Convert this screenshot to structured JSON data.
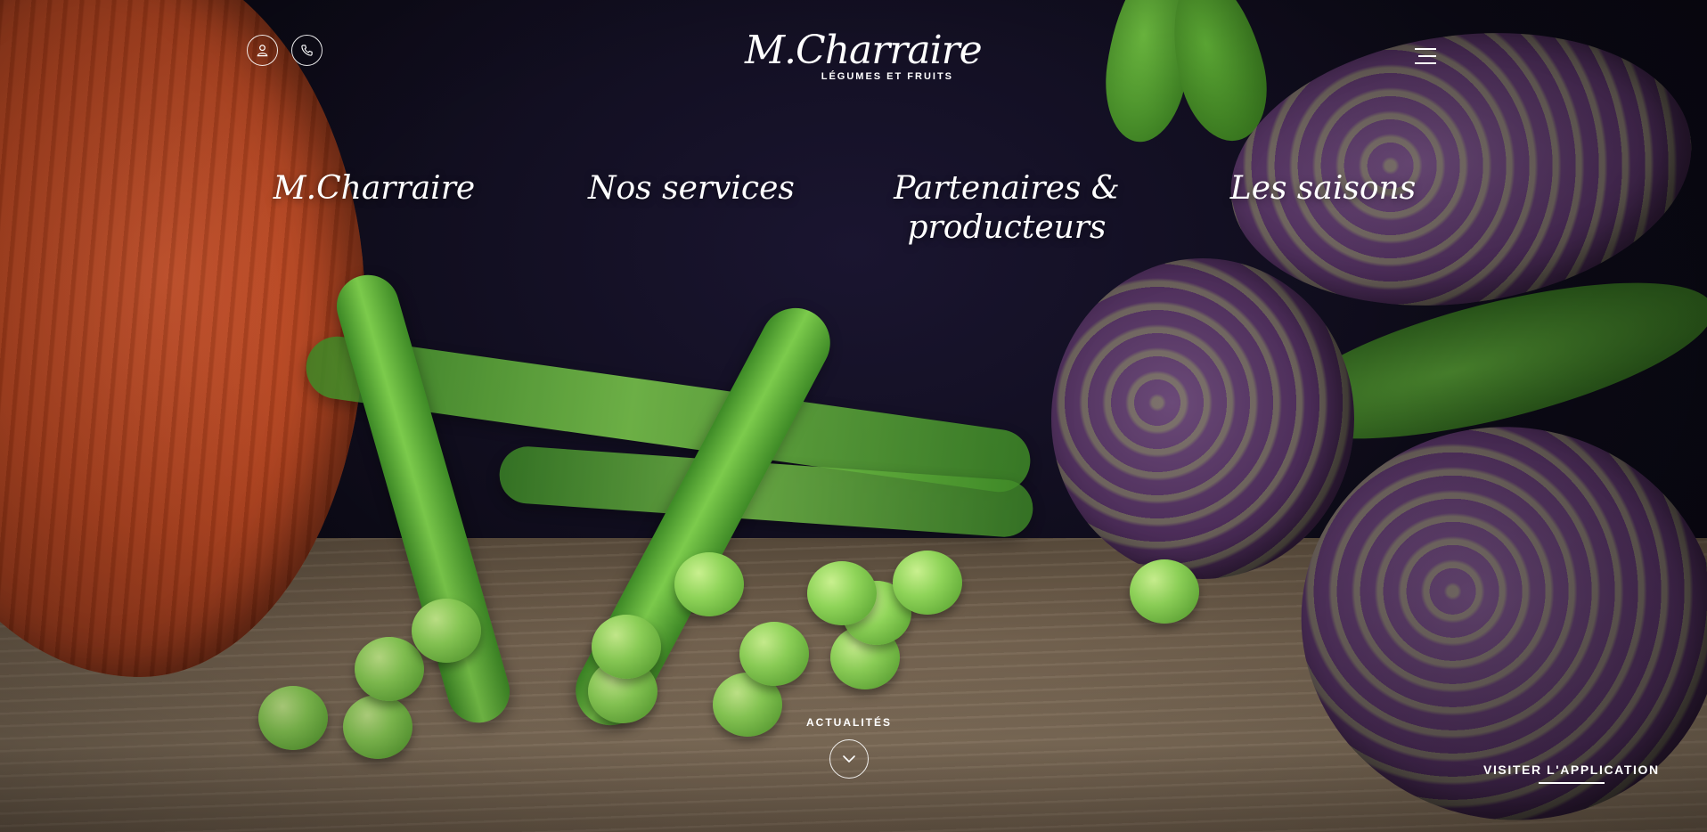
{
  "header": {
    "user_icon": "user-icon",
    "phone_icon": "phone-icon",
    "menu_icon": "hamburger-menu-icon",
    "logo": {
      "main": "M.Charraire",
      "sub": "LÉGUMES ET FRUITS"
    }
  },
  "nav": {
    "items": [
      {
        "label": "M.Charraire"
      },
      {
        "label": "Nos services"
      },
      {
        "label": "Partenaires & producteurs"
      },
      {
        "label": "Les saisons"
      }
    ]
  },
  "footer": {
    "news_label": "ACTUALITÉS",
    "news_icon": "chevron-down-icon",
    "app_label": "VISITER L'APPLICATION"
  },
  "colors": {
    "text": "#ffffff",
    "background": "#0b0912",
    "pumpkin": "#c24a22",
    "pea_green": "#8fd459",
    "artichoke_purple": "#4b2c58"
  }
}
